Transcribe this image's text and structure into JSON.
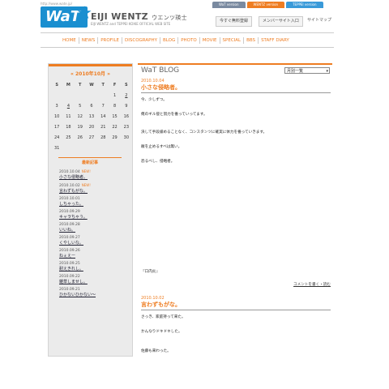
{
  "header": {
    "url_text": "http://www.wate.jp/",
    "logo": "WaT",
    "brand_name": "EIJI WENTZ",
    "brand_kana": "ウエンツ瑛士",
    "brand_sub": "EIJI WENTZ and TEPPEI KOIKE  OFFICIAL WEB SITE",
    "version_tabs": [
      {
        "label": "WaT version",
        "color": "#7a8aa0"
      },
      {
        "label": "WENTZ version",
        "color": "#ee7d22"
      },
      {
        "label": "TEPPEI version",
        "color": "#3a9ad9"
      }
    ],
    "register_button": "今すぐ無料登録",
    "member_button": "メンバーサイト入口",
    "sitemap": "サイトマップ"
  },
  "nav": [
    "HOME",
    "NEWS",
    "PROFILE",
    "DISCOGRAPHY",
    "BLOG",
    "PHOTO",
    "MOVIE",
    "SPECIAL",
    "BBS",
    "STAFF DIARY"
  ],
  "sidebar": {
    "calendar_title": "« 2010年10月 »",
    "weekdays": [
      "S",
      "M",
      "T",
      "W",
      "T",
      "F",
      "S"
    ],
    "weeks": [
      [
        "",
        "",
        "",
        "",
        "",
        "1",
        "2"
      ],
      [
        "3",
        "4",
        "5",
        "6",
        "7",
        "8",
        "9"
      ],
      [
        "10",
        "11",
        "12",
        "13",
        "14",
        "15",
        "16"
      ],
      [
        "17",
        "18",
        "19",
        "20",
        "21",
        "22",
        "23"
      ],
      [
        "24",
        "25",
        "26",
        "27",
        "28",
        "29",
        "30"
      ],
      [
        "31",
        "",
        "",
        "",
        "",
        "",
        ""
      ]
    ],
    "linked_days": [
      "2",
      "4"
    ],
    "recent_title": "最新記事",
    "recent": [
      {
        "date": "2010.10.04",
        "new": "NEW!",
        "title": "小さな侵略者。"
      },
      {
        "date": "2010.10.02",
        "new": "NEW!",
        "title": "言わずもがな。"
      },
      {
        "date": "2010.10.01",
        "new": "",
        "title": "しちゃった。"
      },
      {
        "date": "2010.09.29",
        "new": "",
        "title": "キャラちゃう。"
      },
      {
        "date": "2010.09.28",
        "new": "",
        "title": "いいね。"
      },
      {
        "date": "2010.09.27",
        "new": "",
        "title": "くやしいな。"
      },
      {
        "date": "2010.09.26",
        "new": "",
        "title": "ねぇえー"
      },
      {
        "date": "2010.09.25",
        "new": "",
        "title": "耐えきれし。"
      },
      {
        "date": "2010.09.22",
        "new": "",
        "title": "雑草しませし。"
      },
      {
        "date": "2010.09.21",
        "new": "",
        "title": "ひかないひかない〜"
      }
    ]
  },
  "main": {
    "blog_title": "WaT BLOG",
    "select_value": "月別一覧",
    "posts": [
      {
        "date": "2010.10.04",
        "title": "小さな侵略者。",
        "lines": [
          "今、少しずつ。",
          "俺のギル侵と努力を養っていってます。",
          "決して手段緩めることなく、コンスタンツに確実に体力を養っていきます。",
          "敵を止めるすべは無い。",
          "恐るべし、侵略者。"
        ],
        "signature": "『口内炎』",
        "comment_link": "コメントを書く・読む"
      },
      {
        "date": "2010.10.02",
        "title": "言わずもがな。",
        "lines": [
          "さっき、家庭持って来た。",
          "かんなりドキドキした。",
          "佐藤も来わった。"
        ]
      }
    ]
  }
}
